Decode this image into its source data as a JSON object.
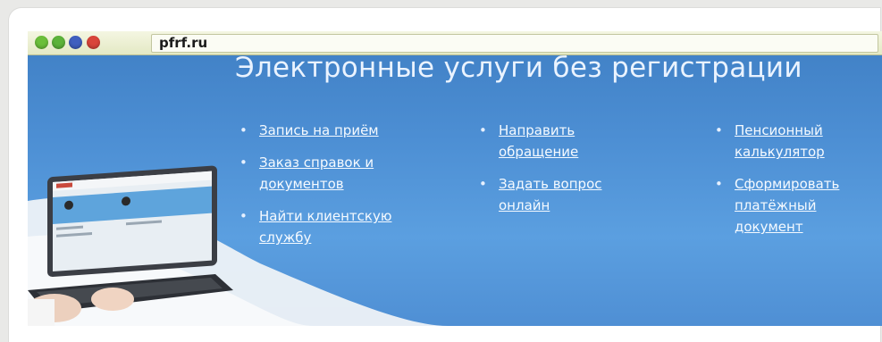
{
  "browser": {
    "url": "pfrf.ru",
    "buttons": [
      {
        "name": "green",
        "color": "#6bbf3a"
      },
      {
        "name": "green",
        "color": "#5cb33a"
      },
      {
        "name": "blue",
        "color": "#3f5fbf"
      },
      {
        "name": "red",
        "color": "#d9453a"
      }
    ]
  },
  "page": {
    "headline": "Электронные услуги без регистрации",
    "columns": [
      {
        "items": [
          {
            "line1": "Запись на приём",
            "line2": ""
          },
          {
            "line1": "Заказ справок и",
            "line2": "документов"
          },
          {
            "line1": "Найти клиентскую",
            "line2": "службу"
          }
        ]
      },
      {
        "items": [
          {
            "line1": "Направить",
            "line2": "обращение"
          },
          {
            "line1": "Задать вопрос",
            "line2": "онлайн"
          }
        ]
      },
      {
        "items": [
          {
            "line1": "Пенсионный",
            "line2": "калькулятор"
          },
          {
            "line1": "Сформировать",
            "line2": "платёжный",
            "line3": "документ"
          }
        ]
      }
    ],
    "bullet": "•"
  },
  "colors": {
    "background_blue": "#4c8ed3",
    "link_text": "#f5faff"
  }
}
